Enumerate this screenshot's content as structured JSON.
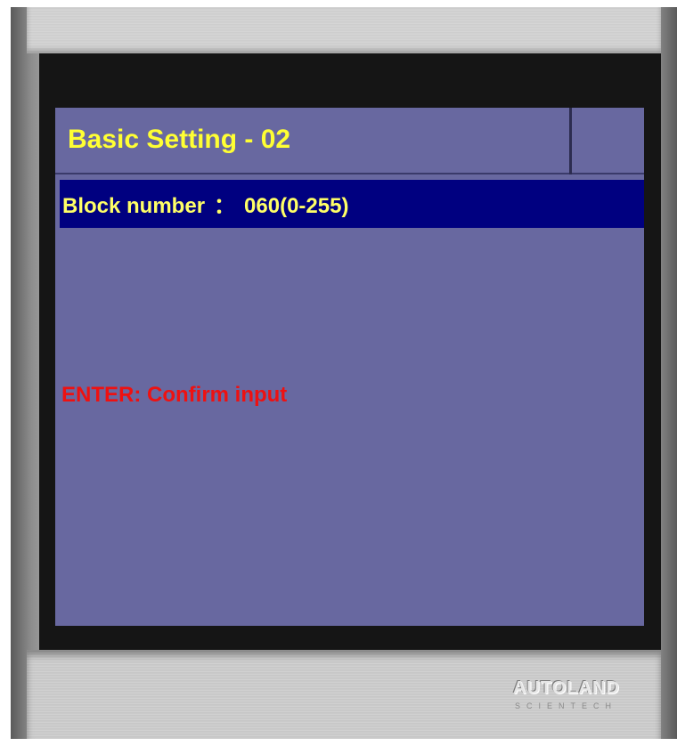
{
  "screen": {
    "title": "Basic Setting - 02",
    "selected_row": {
      "label": "Block number",
      "separator": "：",
      "value": "060(0-255)"
    },
    "hint": "ENTER: Confirm input"
  },
  "brand": {
    "logo_text": "AUTOLAND",
    "logo_subtext": "SCIENTECH"
  },
  "colors": {
    "screen_bg": "#6868a0",
    "selected_row_bg": "#000080",
    "title_text": "#ffff33",
    "row_text": "#ffff66",
    "hint_text": "#ee1111"
  }
}
